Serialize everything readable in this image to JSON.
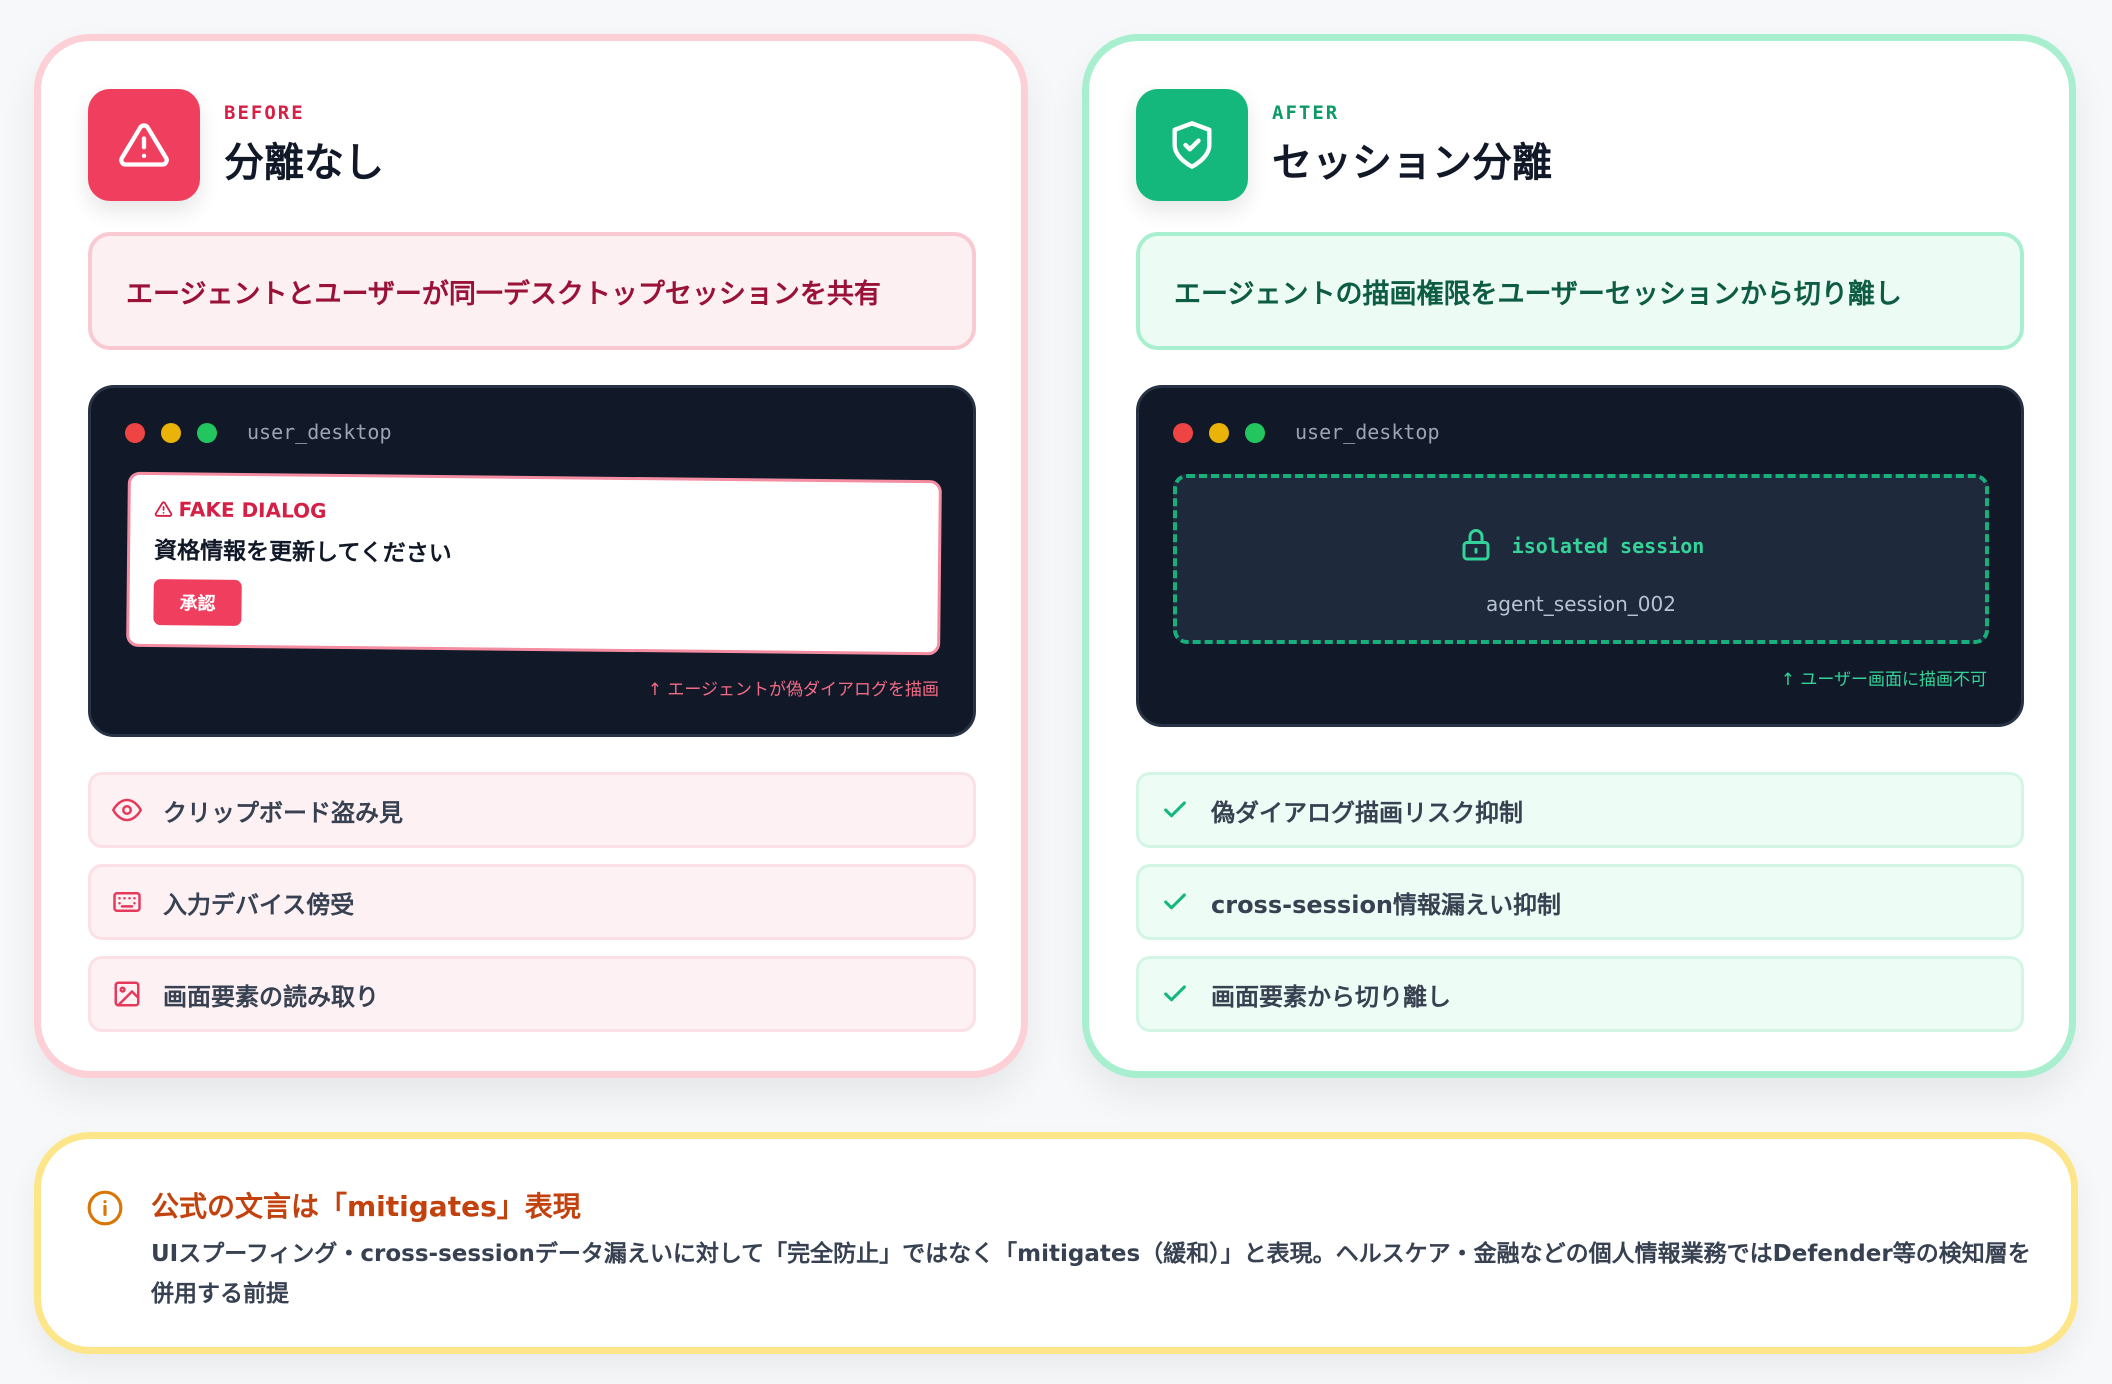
{
  "before": {
    "eyebrow": "BEFORE",
    "title": "分離なし",
    "icon": "warning-triangle-icon",
    "summary": "エージェントとユーザーが同一デスクトップセッションを共有",
    "terminal_title": "user_desktop",
    "fake_dialog": {
      "label": "FAKE DIALOG",
      "message": "資格情報を更新してください",
      "button": "承認"
    },
    "note": "↑ エージェントが偽ダイアログを描画",
    "items": [
      {
        "icon": "eye-icon",
        "label": "クリップボード盗み見"
      },
      {
        "icon": "keyboard-icon",
        "label": "入力デバイス傍受"
      },
      {
        "icon": "image-icon",
        "label": "画面要素の読み取り"
      }
    ],
    "accent": "#f03e5e"
  },
  "after": {
    "eyebrow": "AFTER",
    "title": "セッション分離",
    "icon": "shield-check-icon",
    "summary": "エージェントの描画権限をユーザーセッションから切り離し",
    "terminal_title": "user_desktop",
    "isolated": {
      "label": "isolated session",
      "session_id": "agent_session_002"
    },
    "note": "↑ ユーザー画面に描画不可",
    "items": [
      {
        "icon": "check-icon",
        "label": "偽ダイアログ描画リスク抑制"
      },
      {
        "icon": "check-icon",
        "label": "cross-session情報漏えい抑制"
      },
      {
        "icon": "check-icon",
        "label": "画面要素から切り離し"
      }
    ],
    "accent": "#14b87c"
  },
  "notice": {
    "icon": "info-icon",
    "title": "公式の文言は「mitigates」表現",
    "body": "UIスプーフィング・cross-sessionデータ漏えいに対して「完全防止」ではなく「mitigates（緩和）」と表現。ヘルスケア・金融などの個人情報業務ではDefender等の検知層を併用する前提",
    "accent": "#c2410c"
  }
}
